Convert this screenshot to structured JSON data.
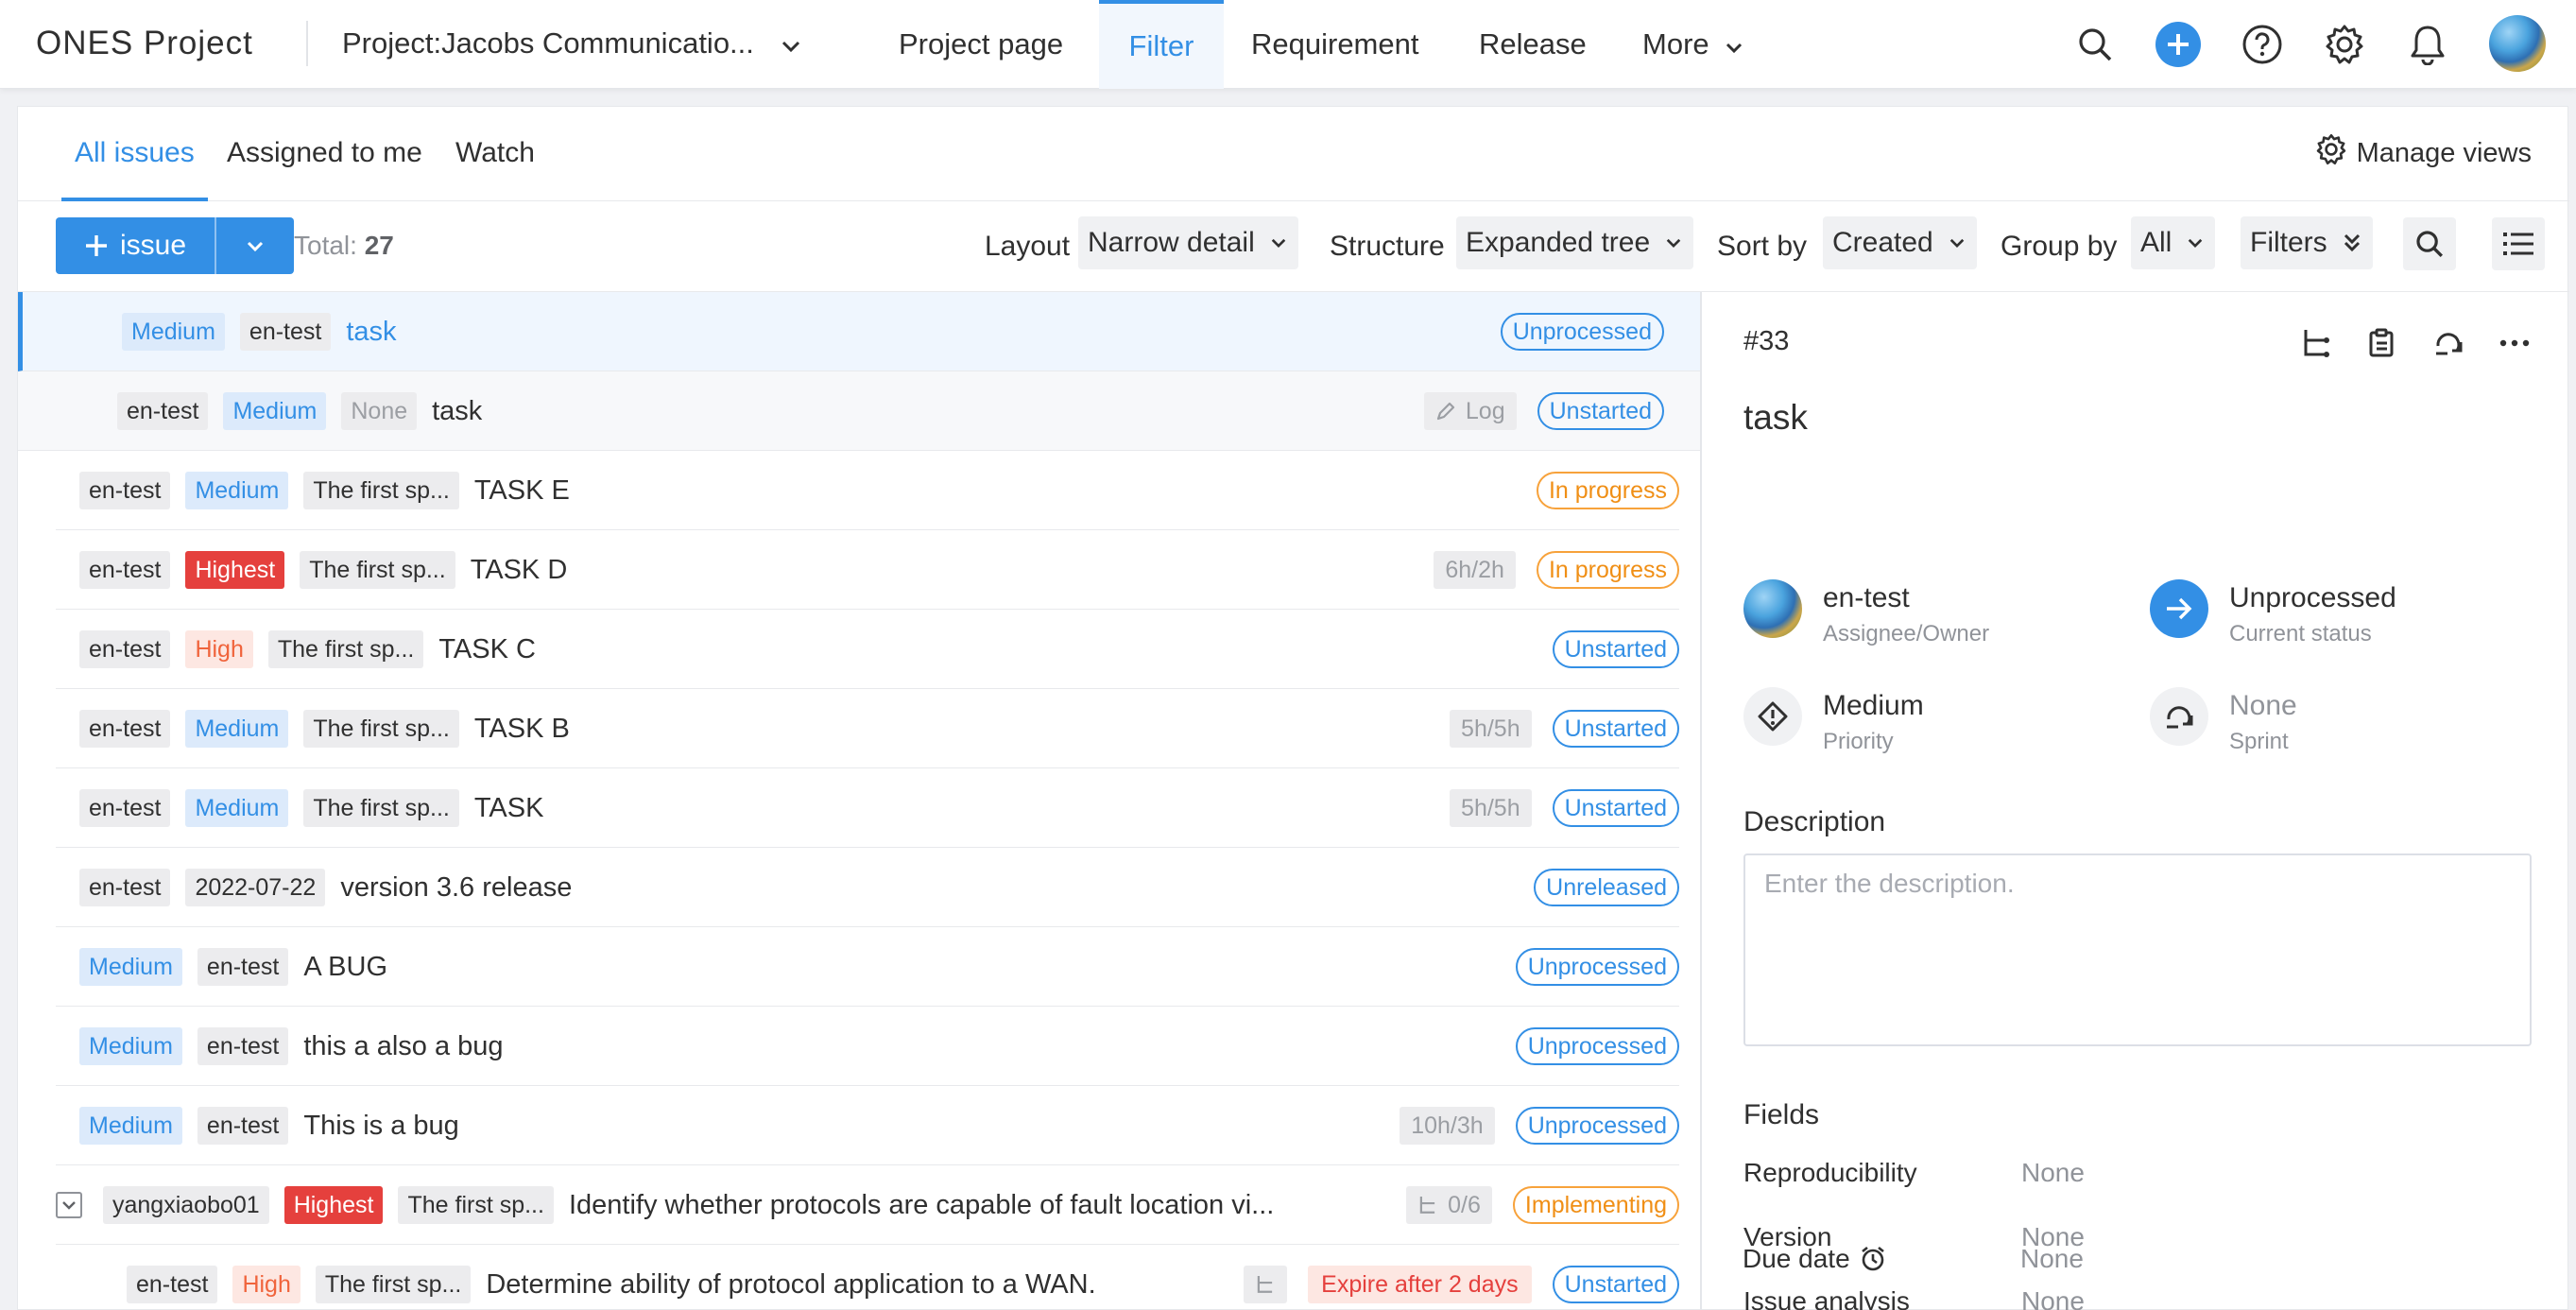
{
  "nav": {
    "brand": "ONES Project",
    "project": "Project:Jacobs Communicatio...",
    "tabs": [
      "Project page",
      "Filter",
      "Requirement",
      "Release",
      "More"
    ],
    "active_tab": "Filter"
  },
  "subtabs": {
    "items": [
      "All issues",
      "Assigned to me",
      "Watch"
    ],
    "active": "All issues",
    "manage_views": "Manage views"
  },
  "toolbar": {
    "add_label": "issue",
    "total_label": "Total:",
    "total_count": "27",
    "layout_label": "Layout",
    "layout_value": "Narrow detail",
    "structure_label": "Structure",
    "structure_value": "Expanded tree",
    "sort_label": "Sort by",
    "sort_value": "Created",
    "group_label": "Group by",
    "group_value": "All",
    "filters_label": "Filters"
  },
  "rows": [
    {
      "tags": [
        {
          "t": "Medium",
          "k": "medium"
        },
        {
          "t": "en-test",
          "k": ""
        }
      ],
      "title": "task",
      "status": "Unprocessed",
      "status_kind": ""
    },
    {
      "tags": [
        {
          "t": "en-test",
          "k": ""
        },
        {
          "t": "Medium",
          "k": "medium"
        },
        {
          "t": "None",
          "k": "none"
        }
      ],
      "title": "task",
      "log": "Log",
      "status": "Unstarted",
      "status_kind": ""
    },
    {
      "tags": [
        {
          "t": "en-test",
          "k": ""
        },
        {
          "t": "Medium",
          "k": "medium"
        },
        {
          "t": "The first sp...",
          "k": ""
        }
      ],
      "title": "TASK E",
      "status": "In progress",
      "status_kind": "progress"
    },
    {
      "tags": [
        {
          "t": "en-test",
          "k": ""
        },
        {
          "t": "Highest",
          "k": "highest"
        },
        {
          "t": "The first sp...",
          "k": ""
        }
      ],
      "title": "TASK D",
      "meta": "6h/2h",
      "status": "In progress",
      "status_kind": "progress"
    },
    {
      "tags": [
        {
          "t": "en-test",
          "k": ""
        },
        {
          "t": "High",
          "k": "high"
        },
        {
          "t": "The first sp...",
          "k": ""
        }
      ],
      "title": "TASK C",
      "status": "Unstarted",
      "status_kind": ""
    },
    {
      "tags": [
        {
          "t": "en-test",
          "k": ""
        },
        {
          "t": "Medium",
          "k": "medium"
        },
        {
          "t": "The first sp...",
          "k": ""
        }
      ],
      "title": "TASK B",
      "meta": "5h/5h",
      "status": "Unstarted",
      "status_kind": ""
    },
    {
      "tags": [
        {
          "t": "en-test",
          "k": ""
        },
        {
          "t": "Medium",
          "k": "medium"
        },
        {
          "t": "The first sp...",
          "k": ""
        }
      ],
      "title": "TASK",
      "meta": "5h/5h",
      "status": "Unstarted",
      "status_kind": ""
    },
    {
      "tags": [
        {
          "t": "en-test",
          "k": ""
        },
        {
          "t": "2022-07-22",
          "k": ""
        }
      ],
      "title": "version 3.6 release",
      "status": "Unreleased",
      "status_kind": ""
    },
    {
      "tags": [
        {
          "t": "Medium",
          "k": "medium"
        },
        {
          "t": "en-test",
          "k": ""
        }
      ],
      "title": "A BUG",
      "status": "Unprocessed",
      "status_kind": ""
    },
    {
      "tags": [
        {
          "t": "Medium",
          "k": "medium"
        },
        {
          "t": "en-test",
          "k": ""
        }
      ],
      "title": "this a also a bug",
      "status": "Unprocessed",
      "status_kind": ""
    },
    {
      "tags": [
        {
          "t": "Medium",
          "k": "medium"
        },
        {
          "t": "en-test",
          "k": ""
        }
      ],
      "title": "This is a bug",
      "meta": "10h/3h",
      "status": "Unprocessed",
      "status_kind": ""
    },
    {
      "tags": [
        {
          "t": "yangxiaobo01",
          "k": ""
        },
        {
          "t": "Highest",
          "k": "highest"
        },
        {
          "t": "The first sp...",
          "k": ""
        }
      ],
      "title": "Identify whether protocols are capable of fault location vi...",
      "subtasks": "0/6",
      "status": "Implementing",
      "status_kind": "progress",
      "checkbox": true
    },
    {
      "tags": [
        {
          "t": "en-test",
          "k": ""
        },
        {
          "t": "High",
          "k": "high"
        },
        {
          "t": "The first sp...",
          "k": ""
        }
      ],
      "title": "Determine ability of protocol application to a WAN.",
      "expire": "Expire after 2 days",
      "status": "Unstarted",
      "status_kind": "",
      "child": true
    }
  ],
  "detail": {
    "id": "#33",
    "title": "task",
    "assignee": "en-test",
    "assignee_label": "Assignee/Owner",
    "status": "Unprocessed",
    "status_label": "Current status",
    "priority": "Medium",
    "priority_label": "Priority",
    "sprint": "None",
    "sprint_label": "Sprint",
    "description_heading": "Description",
    "description_placeholder": "Enter the description.",
    "fields_heading": "Fields",
    "fields": [
      {
        "label": "Reproducibility",
        "value": "None"
      },
      {
        "label": "Version",
        "value": "None"
      },
      {
        "label": "Issue analysis",
        "value": "None"
      },
      {
        "label": "Due date",
        "value": "None"
      }
    ]
  },
  "colors": {
    "accent": "#338fe5",
    "danger": "#e5403d",
    "warning": "#f7a23b"
  }
}
